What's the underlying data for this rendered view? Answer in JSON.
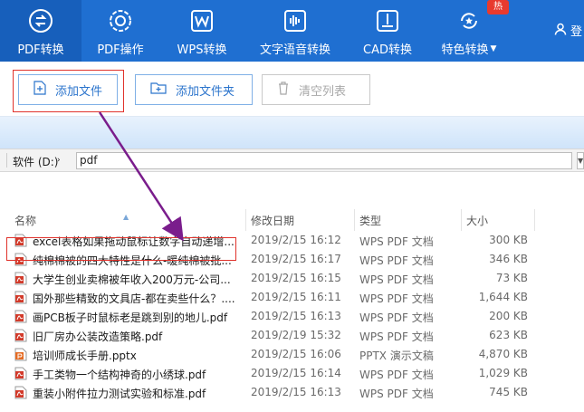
{
  "nav": {
    "items": [
      {
        "label": "PDF转换",
        "icon": "pdf-convert-icon"
      },
      {
        "label": "PDF操作",
        "icon": "gear-icon"
      },
      {
        "label": "WPS转换",
        "icon": "wps-icon"
      },
      {
        "label": "文字语音转换",
        "icon": "voice-wave-icon"
      },
      {
        "label": "CAD转换",
        "icon": "cad-icon"
      },
      {
        "label": "特色转换",
        "icon": "star-refresh-icon"
      }
    ],
    "hot_badge": "热",
    "user_label": "登",
    "accent": "#1f6fd1"
  },
  "toolbar": {
    "add_file": "添加文件",
    "add_folder": "添加文件夹",
    "clear_list": "清空列表"
  },
  "path": {
    "drive": "软件 (D:)",
    "folder": "pdf"
  },
  "columns": {
    "name": "名称",
    "date": "修改日期",
    "type": "类型",
    "size": "大小"
  },
  "files": [
    {
      "name": "excel表格如果拖动鼠标让数字自动递增...",
      "date": "2019/2/15 16:12",
      "type": "WPS PDF 文档",
      "size": "300 KB",
      "icon": "pdf-file-icon"
    },
    {
      "name": "纯棉棉被的四大特性是什么-暖纯棉被批...",
      "date": "2019/2/15 16:17",
      "type": "WPS PDF 文档",
      "size": "346 KB",
      "icon": "pdf-file-icon"
    },
    {
      "name": "大学生创业卖棉被年收入200万元-公司...",
      "date": "2019/2/15 16:15",
      "type": "WPS PDF 文档",
      "size": "73 KB",
      "icon": "pdf-file-icon"
    },
    {
      "name": "国外那些精致的文具店-都在卖些什么？....",
      "date": "2019/2/15 16:11",
      "type": "WPS PDF 文档",
      "size": "1,644 KB",
      "icon": "pdf-file-icon"
    },
    {
      "name": "画PCB板子时鼠标老是跳到别的地儿.pdf",
      "date": "2019/2/15 16:13",
      "type": "WPS PDF 文档",
      "size": "200 KB",
      "icon": "pdf-file-icon"
    },
    {
      "name": "旧厂房办公装改造策略.pdf",
      "date": "2019/2/19 15:32",
      "type": "WPS PDF 文档",
      "size": "623 KB",
      "icon": "pdf-file-icon"
    },
    {
      "name": "培训师成长手册.pptx",
      "date": "2019/2/15 16:06",
      "type": "PPTX 演示文稿",
      "size": "4,870 KB",
      "icon": "pptx-file-icon"
    },
    {
      "name": "手工类物一个结构神奇的小绣球.pdf",
      "date": "2019/2/15 16:14",
      "type": "WPS PDF 文档",
      "size": "1,029 KB",
      "icon": "pdf-file-icon"
    },
    {
      "name": "重装小附件拉力测试实验和标准.pdf",
      "date": "2019/2/15 16:13",
      "type": "WPS PDF 文档",
      "size": "745 KB",
      "icon": "pdf-file-icon"
    }
  ]
}
